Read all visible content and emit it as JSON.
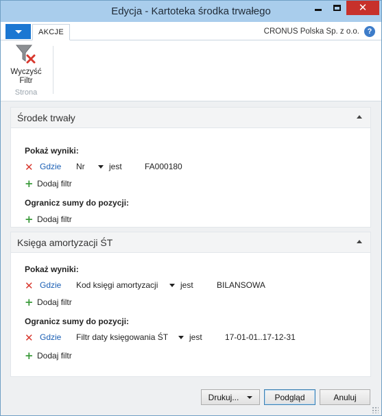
{
  "window": {
    "title": "Edycja - Kartoteka środka trwałego"
  },
  "ribbon": {
    "tab": "AKCJE",
    "company": "CRONUS Polska Sp. z o.o.",
    "help": "?",
    "clear_filter_line1": "Wyczyść",
    "clear_filter_line2": "Filtr",
    "group": "Strona"
  },
  "sections": [
    {
      "title": "Środek trwały",
      "show_label": "Pokaż wyniki:",
      "show_filters": [
        {
          "where": "Gdzie",
          "field": "Nr",
          "op": "jest",
          "value": "FA000180"
        }
      ],
      "add_filter": "Dodaj filtr",
      "limit_label": "Ogranicz sumy do pozycji:",
      "limit_filters": [],
      "add_filter_2": "Dodaj filtr"
    },
    {
      "title": "Księga amortyzacji ŚT",
      "show_label": "Pokaż wyniki:",
      "show_filters": [
        {
          "where": "Gdzie",
          "field": "Kod księgi amortyzacji",
          "op": "jest",
          "value": "BILANSOWA"
        }
      ],
      "add_filter": "Dodaj filtr",
      "limit_label": "Ogranicz sumy do pozycji:",
      "limit_filters": [
        {
          "where": "Gdzie",
          "field": "Filtr daty księgowania ŚT",
          "op": "jest",
          "value": "17-01-01..17-12-31"
        }
      ],
      "add_filter_2": "Dodaj filtr"
    }
  ],
  "footer": {
    "print": "Drukuj...",
    "preview": "Podgląd",
    "cancel": "Anuluj"
  },
  "icons": {
    "remove_filter": "red-x-icon",
    "add_filter": "green-plus-icon",
    "clear_filter": "funnel-clear-icon"
  },
  "colors": {
    "titlebar": "#a9cdec",
    "accent": "#1b77d2",
    "link": "#1a5fb4",
    "remove": "#d8382e",
    "add": "#3a9a3a",
    "close": "#c7312b"
  }
}
